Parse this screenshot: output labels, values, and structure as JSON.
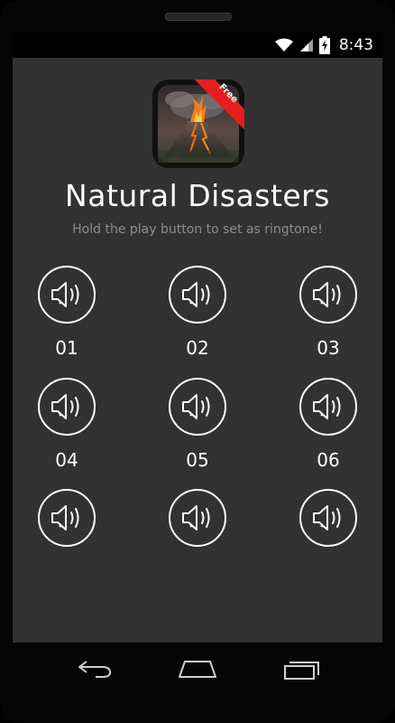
{
  "status_bar": {
    "time": "8:43",
    "icons": [
      "wifi-icon",
      "signal-icon",
      "battery-charging-icon"
    ]
  },
  "app": {
    "title": "Natural Disasters",
    "subtitle": "Hold the play button to set as ringtone!",
    "badge": "Free",
    "icon": "volcano-icon"
  },
  "sounds": [
    {
      "label": "01"
    },
    {
      "label": "02"
    },
    {
      "label": "03"
    },
    {
      "label": "04"
    },
    {
      "label": "05"
    },
    {
      "label": "06"
    },
    {
      "label": ""
    },
    {
      "label": ""
    },
    {
      "label": ""
    }
  ],
  "navigation": {
    "buttons": [
      "back-icon",
      "home-icon",
      "recent-apps-icon"
    ]
  },
  "colors": {
    "screen_background": "#323232",
    "text": "#ffffff",
    "subtitle": "#8c8c8c",
    "badge": "#e61e1e"
  }
}
